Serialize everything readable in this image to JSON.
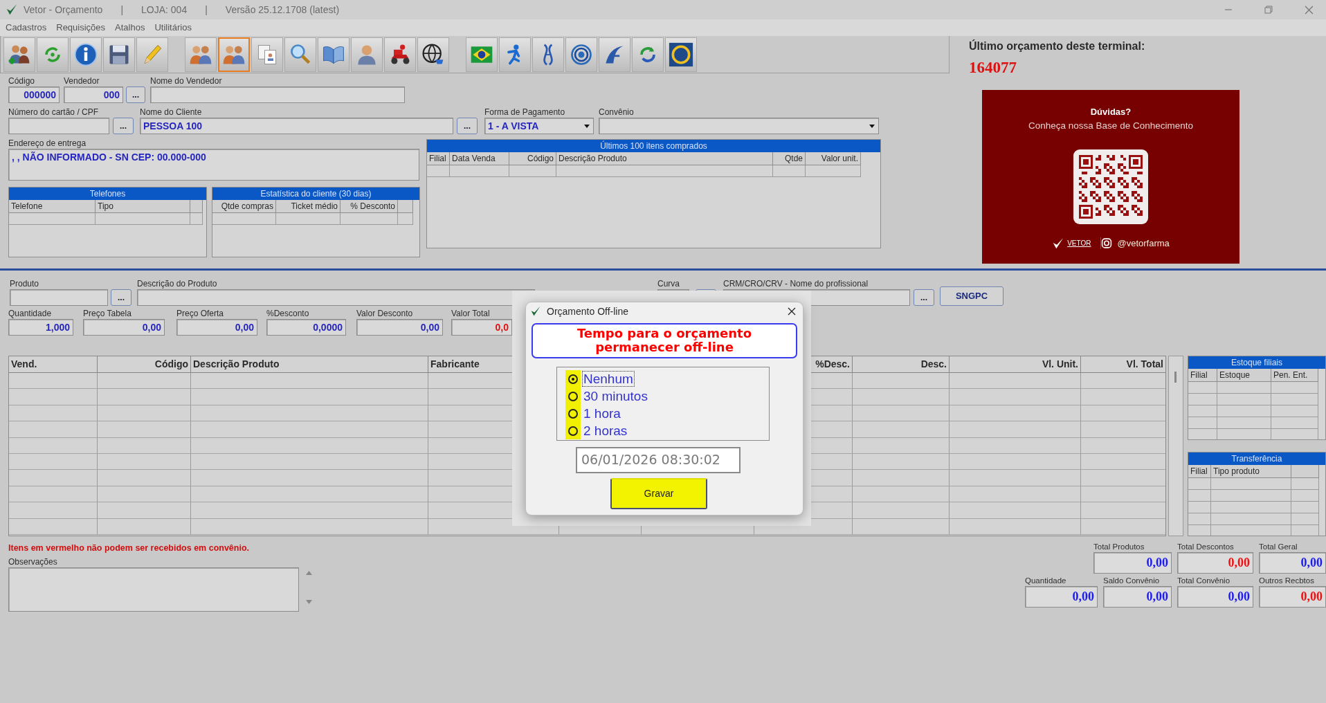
{
  "window": {
    "title_parts": [
      "Vetor - Orçamento",
      "|",
      "LOJA: 004",
      "|",
      "Versão 25.12.1708 (latest)"
    ]
  },
  "menu": [
    "Cadastros",
    "Requisições",
    "Atalhos",
    "Utilitários"
  ],
  "toolbar": [
    {
      "kind": "people-add",
      "selected": false
    },
    {
      "kind": "recycle",
      "selected": false
    },
    {
      "kind": "info",
      "selected": false
    },
    {
      "kind": "floppy",
      "selected": false
    },
    {
      "kind": "pencil",
      "selected": false
    },
    {
      "kind": "people",
      "selected": false
    },
    {
      "kind": "people",
      "selected": true
    },
    {
      "kind": "documents",
      "selected": false
    },
    {
      "kind": "search",
      "selected": false
    },
    {
      "kind": "book",
      "selected": false
    },
    {
      "kind": "person",
      "selected": false
    },
    {
      "kind": "scooter",
      "selected": false
    },
    {
      "kind": "globe",
      "selected": false
    },
    {
      "kind": "flag",
      "selected": false
    },
    {
      "kind": "figure",
      "selected": false
    },
    {
      "kind": "helix",
      "selected": false
    },
    {
      "kind": "spiral",
      "selected": false
    },
    {
      "kind": "swoosh",
      "selected": false
    },
    {
      "kind": "refresh",
      "selected": false
    },
    {
      "kind": "ring",
      "selected": false
    }
  ],
  "header_rows": [
    [
      {
        "kind": "number",
        "label": "Código",
        "value": "000000"
      },
      {
        "kind": "number",
        "label": "Vendedor",
        "value": "000"
      },
      {
        "kind": "button",
        "text": "..."
      },
      {
        "kind": "text",
        "label": "Nome do Vendedor"
      }
    ],
    [
      {
        "kind": "text",
        "label": "Número do cartão / CPF"
      },
      {
        "kind": "button",
        "text": "..."
      },
      {
        "kind": "text",
        "label": "Nome do Cliente",
        "value": "PESSOA 100"
      },
      {
        "kind": "button",
        "text": "..."
      },
      {
        "kind": "select",
        "label": "Forma de Pagamento",
        "value": "1 - A VISTA"
      },
      {
        "kind": "select",
        "label": "Convênio"
      }
    ]
  ],
  "address": {
    "label": "Endereço de entrega",
    "value": ", , NÃO INFORMADO - SN CEP: 00.000-000"
  },
  "phones": {
    "title": "Telefones",
    "columns": [
      "Telefone",
      "Tipo"
    ]
  },
  "stats": {
    "title": "Estatística do cliente (30 dias)",
    "columns": [
      "Qtde compras",
      "Ticket médio",
      "% Desconto"
    ]
  },
  "recent": {
    "title": "Últimos 100 itens comprados",
    "columns": [
      "Filial",
      "Data Venda",
      "Código",
      "Descrição Produto",
      "Qtde",
      "Valor unit."
    ]
  },
  "last_quote": {
    "label": "Último orçamento deste terminal:",
    "number": "164077"
  },
  "promo": {
    "title": "Dúvidas?",
    "subtitle": "Conheça nossa Base de Conhecimento",
    "brand": "VETOR",
    "handle": "@vetorfarma"
  },
  "product_rows": [
    [
      {
        "kind": "text",
        "label": "Produto"
      },
      {
        "kind": "button",
        "text": "..."
      },
      {
        "kind": "text",
        "label": "Descrição do Produto"
      },
      {
        "kind": "text",
        "label": "Curva"
      },
      {
        "kind": "blank"
      },
      {
        "kind": "text",
        "label": "CRM/CRO/CRV - Nome do profissional"
      },
      {
        "kind": "button",
        "text": "..."
      },
      {
        "kind": "button",
        "text": "SNGPC"
      }
    ],
    [
      {
        "kind": "number",
        "label": "Quantidade",
        "value": "1,000",
        "alert": false
      },
      {
        "kind": "number",
        "label": "Preço Tabela",
        "value": "0,00",
        "alert": false
      },
      {
        "kind": "number",
        "label": "Preço Oferta",
        "value": "0,00",
        "alert": false
      },
      {
        "kind": "number",
        "label": "%Desconto",
        "value": "0,0000",
        "alert": false
      },
      {
        "kind": "number",
        "label": "Valor Desconto",
        "value": "0,00",
        "alert": false
      },
      {
        "kind": "number",
        "label": "Valor Total",
        "value": "0,0",
        "alert": true
      }
    ]
  ],
  "items_grid": {
    "columns": [
      "Vend.",
      "Código",
      "Descrição Produto",
      "Fabricante",
      "%Desc.",
      "Desc.",
      "Vl. Unit.",
      "Vl. Total"
    ]
  },
  "stock": {
    "title": "Estoque filiais",
    "columns": [
      "Filial",
      "Estoque",
      "Pen. Ent."
    ]
  },
  "transfer": {
    "title": "Transferência",
    "columns": [
      "Filial",
      "Tipo produto"
    ]
  },
  "notice": "Itens em vermelho não podem ser recebidos em convênio.",
  "notes": {
    "label": "Observações"
  },
  "totals": [
    [
      {
        "label": "Total Produtos",
        "value": "0,00",
        "alert": false
      },
      {
        "label": "Total Descontos",
        "value": "0,00",
        "alert": true
      },
      {
        "label": "Total Geral",
        "value": "0,00",
        "alert": false
      }
    ],
    [
      {
        "label": "Quantidade",
        "value": "0,00",
        "alert": false
      },
      {
        "label": "Saldo Convênio",
        "value": "0,00",
        "alert": false
      },
      {
        "label": "Total Convênio",
        "value": "0,00",
        "alert": false
      },
      {
        "label": "Outros Recbtos",
        "value": "0,00",
        "alert": true
      }
    ]
  ],
  "dialog": {
    "title": "Orçamento Off-line",
    "heading": "Tempo para o orçamento permanecer off-line",
    "options": [
      {
        "label": "Nenhum",
        "selected": true
      },
      {
        "label": "30 minutos",
        "selected": false
      },
      {
        "label": "1 hora",
        "selected": false
      },
      {
        "label": "2 horas",
        "selected": false
      }
    ],
    "until": "06/01/2026 08:30:02",
    "button": "Gravar"
  }
}
